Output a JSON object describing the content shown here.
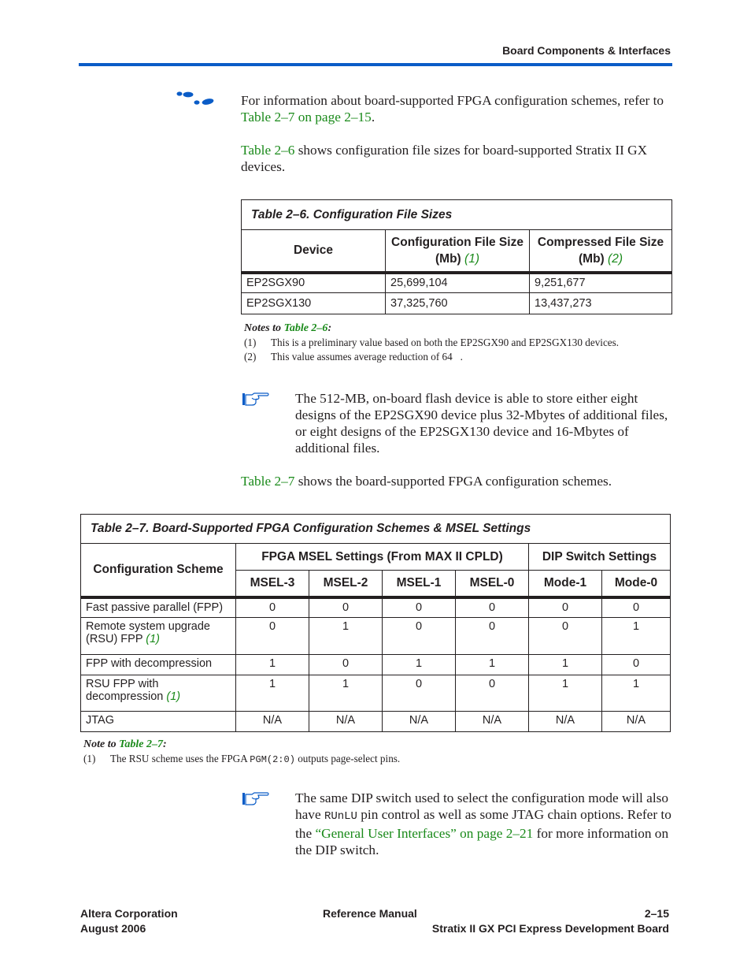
{
  "header": {
    "section_title": "Board Components & Interfaces",
    "rule_color": "#0a5cc7"
  },
  "intro": {
    "icon": "footsteps-icon",
    "p1_text": "For information about board-supported FPGA configuration schemes, refer to ",
    "p1_link": "Table 2–7 on page 2–15",
    "p1_end": ".",
    "p2_link": "Table 2–6",
    "p2_text": " shows configuration file sizes for board-supported Stratix II GX devices."
  },
  "table6": {
    "caption": "Table 2–6. Configuration File Sizes",
    "headers": [
      {
        "label": "Device",
        "note": ""
      },
      {
        "label": "Configuration File Size (Mb)",
        "note": "(1)"
      },
      {
        "label": "Compressed File Size (Mb)",
        "note": "(2)"
      }
    ],
    "rows": [
      [
        "EP2SGX90",
        "25,699,104",
        "9,251,677"
      ],
      [
        "EP2SGX130",
        "37,325,760",
        "13,437,273"
      ]
    ],
    "notes_title": "Notes to ",
    "notes_link": "Table 2–6",
    "notes_colon": ":",
    "notes": [
      {
        "num": "(1)",
        "text": "This is a preliminary value based on both the EP2SGX90 and EP2SGX130 devices."
      },
      {
        "num": "(2)",
        "text": "This value assumes average reduction of 64   ."
      }
    ]
  },
  "flash_note": {
    "icon": "pointing-hand-icon",
    "text": "The 512-MB, on-board flash device is able to store either eight designs of the EP2SGX90 device plus 32-Mbytes of additional files, or eight designs of the EP2SGX130 device and 16-Mbytes of additional files."
  },
  "intro7": {
    "link": "Table 2–7",
    "text": " shows the board-supported FPGA configuration schemes."
  },
  "table7": {
    "caption": "Table 2–7. Board-Supported FPGA Configuration Schemes & MSEL Settings",
    "scheme_header": "Configuration Scheme",
    "group_msel": "FPGA MSEL Settings (From MAX II CPLD)",
    "group_dip": "DIP Switch Settings",
    "columns": [
      "MSEL-3",
      "MSEL-2",
      "MSEL-1",
      "MSEL-0",
      "Mode-1",
      "Mode-0"
    ],
    "rows": [
      {
        "scheme": "Fast passive parallel (FPP)",
        "note": "",
        "values": [
          "0",
          "0",
          "0",
          "0",
          "0",
          "0"
        ]
      },
      {
        "scheme": "Remote system upgrade (RSU) FPP ",
        "note": "(1)",
        "values": [
          "0",
          "1",
          "0",
          "0",
          "0",
          "1"
        ]
      },
      {
        "scheme": "FPP with decompression",
        "note": "",
        "values": [
          "1",
          "0",
          "1",
          "1",
          "1",
          "0"
        ]
      },
      {
        "scheme": "RSU FPP with decompression ",
        "note": "(1)",
        "values": [
          "1",
          "1",
          "0",
          "0",
          "1",
          "1"
        ]
      },
      {
        "scheme": "JTAG",
        "note": "",
        "values": [
          "N/A",
          "N/A",
          "N/A",
          "N/A",
          "N/A",
          "N/A"
        ]
      }
    ],
    "note_title": "Note to ",
    "note_link": "Table 2–7",
    "note_colon": ":",
    "notes": [
      {
        "num": "(1)",
        "pre": "The RSU scheme uses the FPGA ",
        "code": "PGM(2:0)",
        "post": " outputs page-select pins."
      }
    ]
  },
  "dip_note": {
    "icon": "pointing-hand-icon",
    "t1": "The same DIP switch used to select the configuration mode will also have ",
    "code": "RUnLU",
    "t2": " pin control as well as some JTAG chain options. Refer to the ",
    "link": "“General User Interfaces” on page 2–21",
    "t3": " for more information on the DIP switch."
  },
  "footer": {
    "company": "Altera Corporation",
    "date": "August 2006",
    "manual": "Reference Manual",
    "page": "2–15",
    "product": "Stratix II GX PCI Express Development Board"
  }
}
